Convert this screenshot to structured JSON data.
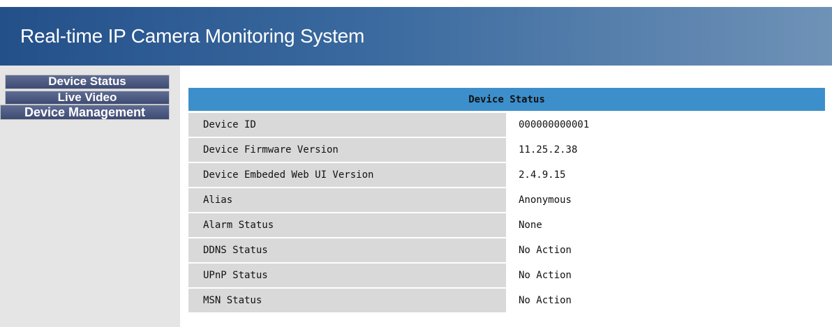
{
  "header": {
    "title": "Real-time IP Camera Monitoring System"
  },
  "sidebar": {
    "items": [
      {
        "label": "Device Status"
      },
      {
        "label": "Live Video"
      },
      {
        "label": "Device Management"
      }
    ]
  },
  "status_table": {
    "title": "Device Status",
    "rows": [
      {
        "label": "Device ID",
        "value": "000000000001"
      },
      {
        "label": "Device Firmware Version",
        "value": "11.25.2.38"
      },
      {
        "label": "Device Embeded Web UI Version",
        "value": "2.4.9.15"
      },
      {
        "label": "Alias",
        "value": "Anonymous"
      },
      {
        "label": "Alarm Status",
        "value": "None"
      },
      {
        "label": "DDNS Status",
        "value": "No Action"
      },
      {
        "label": "UPnP Status",
        "value": "No Action"
      },
      {
        "label": "MSN Status",
        "value": "No Action"
      }
    ]
  },
  "colors": {
    "header_start": "#24508a",
    "header_end": "#6f92b7",
    "nav_button": "#4a5880",
    "table_header": "#3c8fcb",
    "label_cell": "#d9d9d9",
    "sidebar_bg": "#e5e5e5"
  }
}
